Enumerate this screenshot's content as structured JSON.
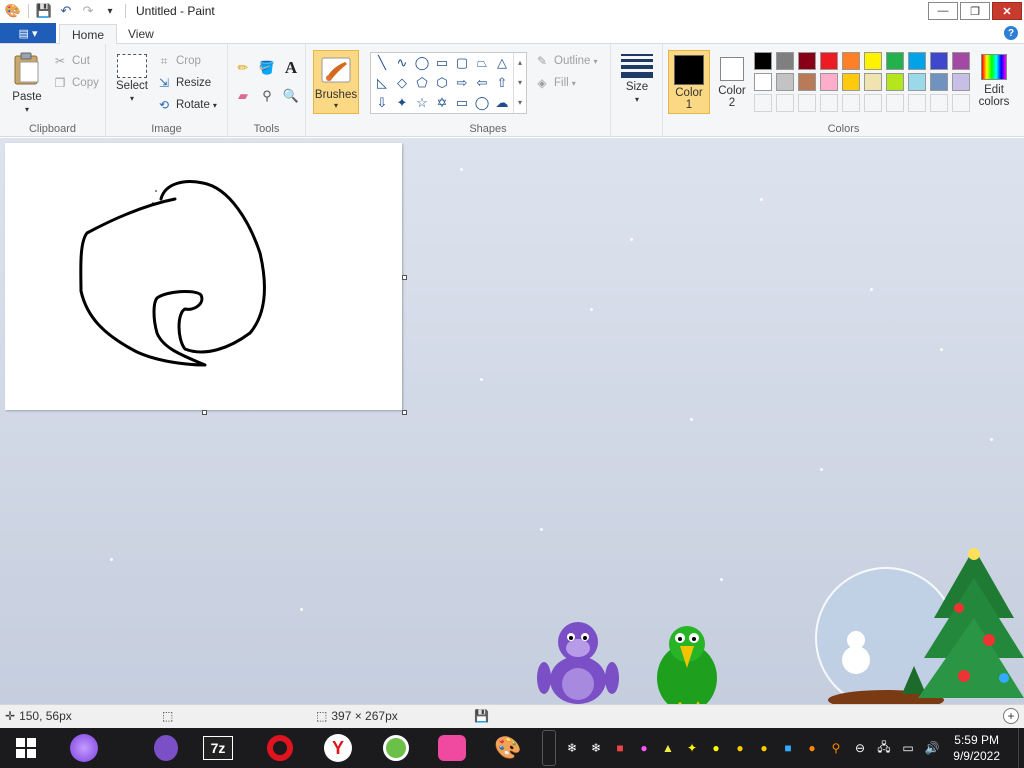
{
  "titlebar": {
    "title": "Untitled - Paint",
    "minimize": "—",
    "maximize": "❐",
    "close": "✕"
  },
  "tabs": {
    "file_label": "▤ ▾",
    "home": "Home",
    "view": "View",
    "help": "?"
  },
  "clipboard": {
    "paste": "Paste",
    "cut": "Cut",
    "copy": "Copy",
    "group": "Clipboard"
  },
  "image": {
    "select": "Select",
    "crop": "Crop",
    "resize": "Resize",
    "rotate": "Rotate",
    "group": "Image"
  },
  "tools": {
    "group": "Tools"
  },
  "brushes": {
    "label": "Brushes"
  },
  "shapes": {
    "outline": "Outline",
    "fill": "Fill",
    "group": "Shapes"
  },
  "size": {
    "label": "Size"
  },
  "colors": {
    "color1": "Color",
    "color1_num": "1",
    "color2": "Color",
    "color2_num": "2",
    "edit": "Edit",
    "edit2": "colors",
    "group": "Colors",
    "row1": [
      "#000000",
      "#7f7f7f",
      "#880015",
      "#ed1c24",
      "#ff7f27",
      "#fff200",
      "#22b14c",
      "#00a2e8",
      "#3f48cc",
      "#a349a4"
    ],
    "row2": [
      "#ffffff",
      "#c3c3c3",
      "#b97a57",
      "#ffaec9",
      "#ffc90e",
      "#efe4b0",
      "#b5e61d",
      "#99d9ea",
      "#7092be",
      "#c8bfe7"
    ],
    "primary": "#000000",
    "secondary": "#ffffff"
  },
  "status": {
    "cursor_pos": "150, 56px",
    "canvas_size": "397 × 267px"
  },
  "clock": {
    "time": "5:59 PM",
    "date": "9/9/2022"
  }
}
